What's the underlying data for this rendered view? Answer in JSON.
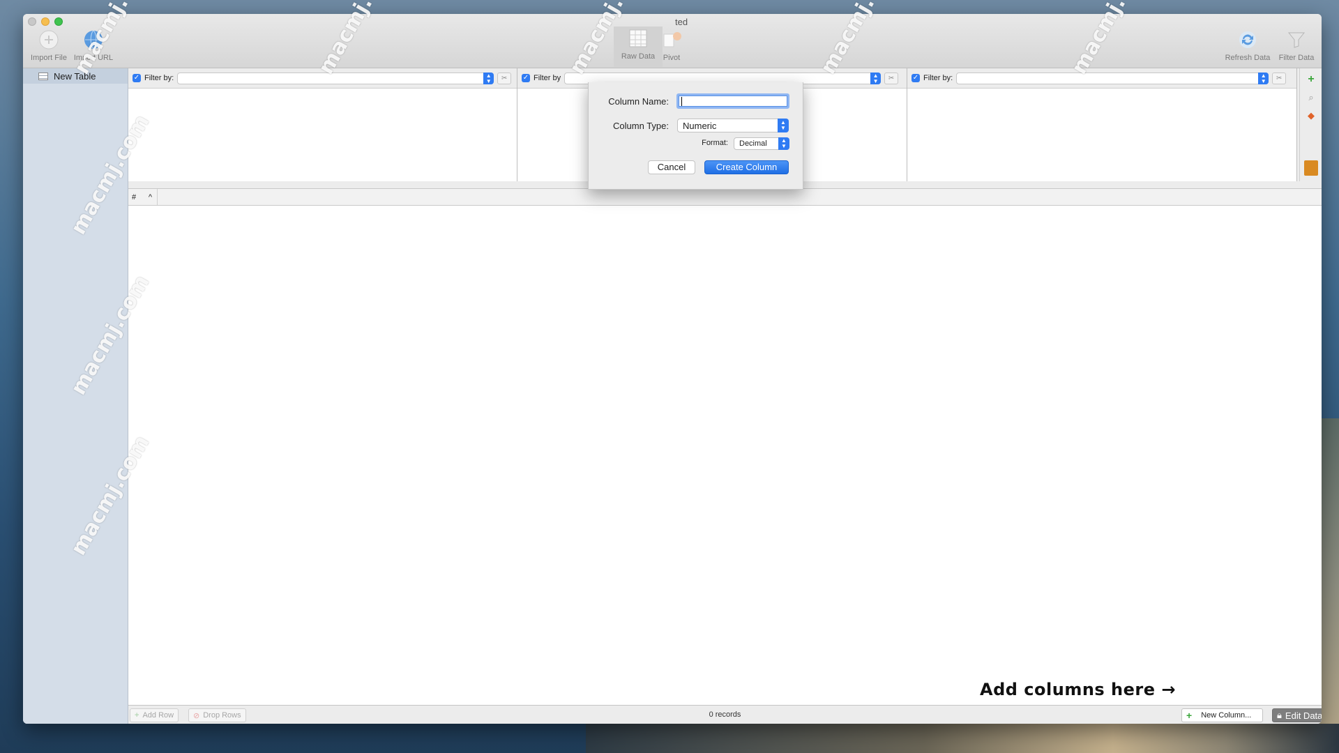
{
  "toolbar": {
    "window_title": "ted",
    "buttons": [
      {
        "label": "Import File",
        "icon": "import-file-icon"
      },
      {
        "label": "Import URL",
        "icon": "globe-icon"
      },
      {
        "label": "Raw Data",
        "icon": "grid-icon"
      },
      {
        "label": "Pivot",
        "icon": "pivot-icon"
      },
      {
        "label": "Refresh Data",
        "icon": "refresh-icon"
      },
      {
        "label": "Filter Data",
        "icon": "funnel-icon"
      }
    ]
  },
  "sidebar": {
    "items": [
      {
        "label": "New Table",
        "icon": "table-icon"
      }
    ]
  },
  "filters": {
    "label": "Filter by:",
    "panes": [
      {
        "checked": true,
        "label": "Filter by:"
      },
      {
        "checked": true,
        "label": "Filter by"
      },
      {
        "checked": true,
        "label": "Filter by:"
      }
    ]
  },
  "table": {
    "columns": [
      "#",
      "^"
    ],
    "records_text": "0 records"
  },
  "bottom_bar": {
    "add_row": "Add Row",
    "drop_rows": "Drop Rows",
    "new_column": "New Column...",
    "edit_data": "Edit Data"
  },
  "dialog": {
    "column_name_label": "Column Name:",
    "column_name_value": "",
    "column_type_label": "Column Type:",
    "column_type_value": "Numeric",
    "format_label": "Format:",
    "format_value": "Decimal",
    "cancel": "Cancel",
    "create": "Create Column"
  },
  "annotation": "Add columns here →",
  "watermark": "macmj.com",
  "colors": {
    "accent": "#2f7bf3",
    "sidebar": "#d4dde8",
    "toolbar": "#e8e8e8"
  }
}
